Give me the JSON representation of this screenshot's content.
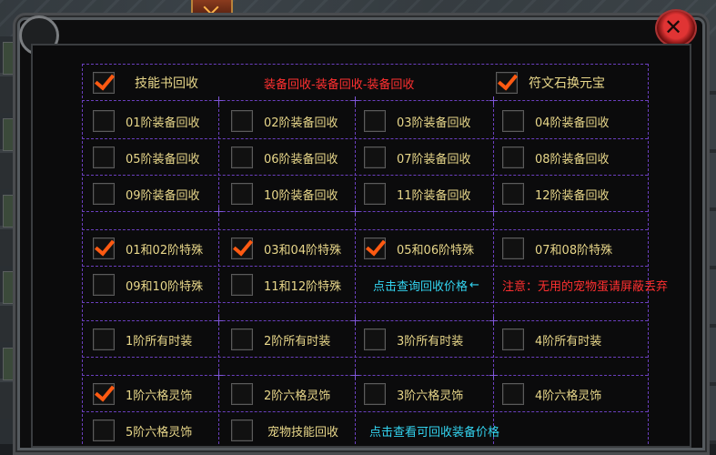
{
  "header": {
    "close_symbol": "✕"
  },
  "top_row": {
    "skill_book_label": "技能书回收",
    "skill_book_checked": true,
    "banner": "装备回收-装备回收-装备回收",
    "rune_label": "符文石换元宝",
    "rune_checked": true
  },
  "equip_rows": [
    [
      {
        "label": "01阶装备回收",
        "checked": false
      },
      {
        "label": "02阶装备回收",
        "checked": false
      },
      {
        "label": "03阶装备回收",
        "checked": false
      },
      {
        "label": "04阶装备回收",
        "checked": false
      }
    ],
    [
      {
        "label": "05阶装备回收",
        "checked": false
      },
      {
        "label": "06阶装备回收",
        "checked": false
      },
      {
        "label": "07阶装备回收",
        "checked": false
      },
      {
        "label": "08阶装备回收",
        "checked": false
      }
    ],
    [
      {
        "label": "09阶装备回收",
        "checked": false
      },
      {
        "label": "10阶装备回收",
        "checked": false
      },
      {
        "label": "11阶装备回收",
        "checked": false
      },
      {
        "label": "12阶装备回收",
        "checked": false
      }
    ]
  ],
  "special_rows": [
    [
      {
        "label": "01和02阶特殊",
        "checked": true
      },
      {
        "label": "03和04阶特殊",
        "checked": true
      },
      {
        "label": "05和06阶特殊",
        "checked": true
      },
      {
        "label": "07和08阶特殊",
        "checked": false
      }
    ],
    [
      {
        "label": "09和10阶特殊",
        "checked": false
      },
      {
        "label": "11和12阶特殊",
        "checked": false
      }
    ]
  ],
  "price_link": "点击查询回收价格",
  "price_arrow": "←",
  "notice": "注意：无用的宠物蛋请屏蔽丢弃",
  "fashion_row": [
    {
      "label": "1阶所有时装",
      "checked": false
    },
    {
      "label": "2阶所有时装",
      "checked": false
    },
    {
      "label": "3阶所有时装",
      "checked": false
    },
    {
      "label": "4阶所有时装",
      "checked": false
    }
  ],
  "ornament_row": [
    {
      "label": "1阶六格灵饰",
      "checked": true
    },
    {
      "label": "2阶六格灵饰",
      "checked": false
    },
    {
      "label": "3阶六格灵饰",
      "checked": false
    },
    {
      "label": "4阶六格灵饰",
      "checked": false
    }
  ],
  "last_row": {
    "ornament5": {
      "label": "5阶六格灵饰",
      "checked": false
    },
    "pet_skill": {
      "label": "宠物技能回收",
      "checked": false
    },
    "view_link": "点击查看可回收装备价格"
  }
}
